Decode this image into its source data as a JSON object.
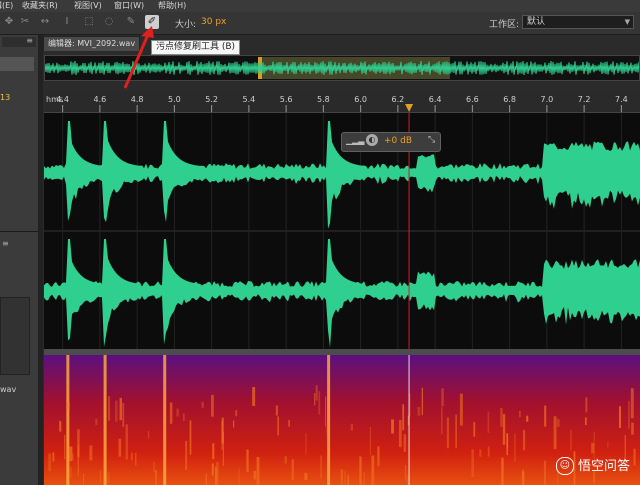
{
  "menu": {
    "items": [
      "编辑(E)",
      "收藏夹(R)",
      "视图(V)",
      "窗口(W)",
      "帮助(H)"
    ]
  },
  "toolbar": {
    "size_label": "大小:",
    "size_value": "30 px",
    "workspace_label": "工作区:",
    "workspace_value": "默认",
    "tooltip": "污点修复刷工具 (B)"
  },
  "left_panel": {
    "value_1": "13",
    "file_suffix": "wav"
  },
  "editor": {
    "tab_label": "编辑器: MVI_2092.wav"
  },
  "ruler": {
    "unit": "hms",
    "ticks": [
      "4.4",
      "4.6",
      "4.8",
      "5.0",
      "5.2",
      "5.4",
      "5.6",
      "5.8",
      "6.0",
      "6.2",
      "6.4",
      "6.6",
      "6.8",
      "7.0",
      "7.2",
      "7.4"
    ],
    "range": [
      4.3,
      7.5
    ],
    "playhead": 6.26
  },
  "volume_hud": {
    "value": "+0 dB"
  },
  "watermark": {
    "text": "悟空问答"
  },
  "colors": {
    "waveform": "#2fcf8f",
    "playhead": "#e0a020",
    "accent": "#f0a020"
  }
}
